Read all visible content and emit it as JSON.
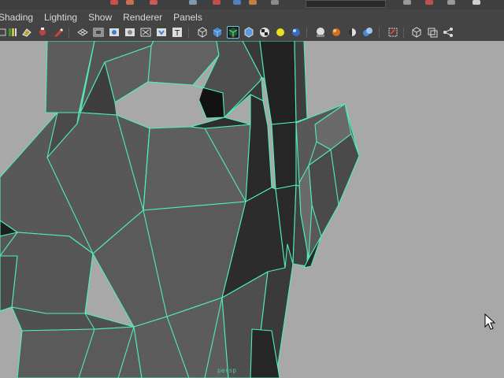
{
  "window": {
    "menus": [
      "Shading",
      "Lighting",
      "Show",
      "Renderer",
      "Panels"
    ]
  },
  "toolbar": {
    "icons": [
      "camera-attributes-icon",
      "bookmarks-icon",
      "image-plane-icon",
      "camera-2d-pan-icon",
      "grease-pencil-icon",
      "wireframe-grid-icon",
      "film-gate-icon",
      "resolution-gate-icon",
      "gate-mask-icon",
      "field-chart-icon",
      "safe-action-icon",
      "safe-title-icon",
      "wireframe-icon",
      "smooth-shade-icon",
      "wireframe-on-shaded-icon",
      "default-material-icon",
      "textured-icon",
      "use-all-lights-icon",
      "shadows-icon",
      "high-quality-icon",
      "ambient-occlusion-icon",
      "motion-blur-icon",
      "multisample-icon",
      "depth-of-field-icon",
      "isolate-select-icon",
      "xray-icon",
      "xray-joints-icon",
      "xray-active-components-icon"
    ],
    "text_icon_glyph": "T"
  },
  "colors": {
    "viewport_background": "#a8a8a8",
    "wireframe": "#4ef0b4",
    "ui_background": "#444444",
    "menu_text": "#d8d8d8",
    "active_button_outline": "#70c0e0"
  },
  "viewport": {
    "axis_label": "persp"
  }
}
